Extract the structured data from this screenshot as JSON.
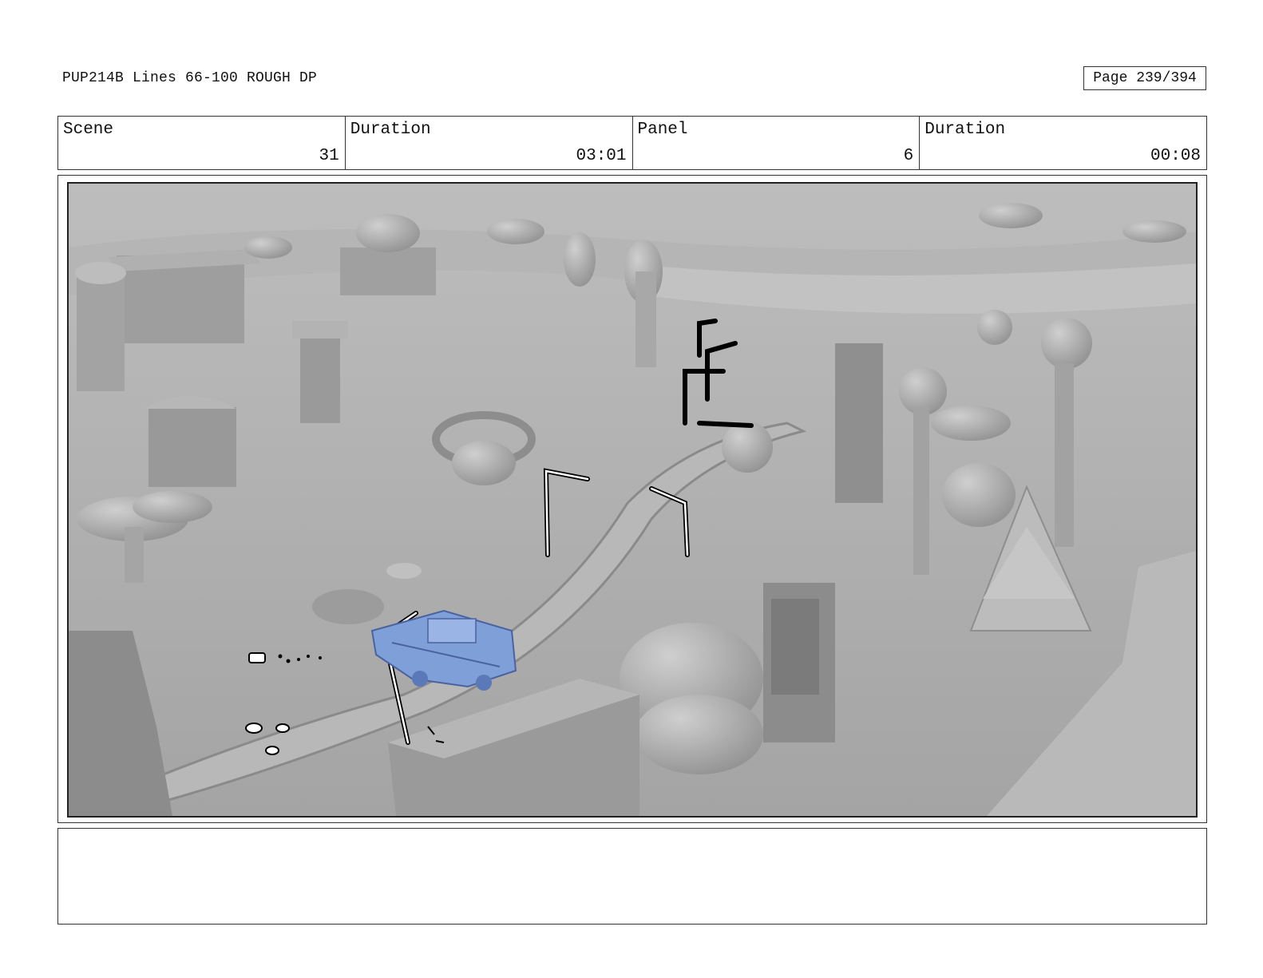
{
  "header": {
    "title": "PUP214B Lines 66-100 ROUGH DP",
    "page": "Page 239/394"
  },
  "info": {
    "scene_label": "Scene",
    "scene_value": "31",
    "scene_duration_label": "Duration",
    "scene_duration_value": "03:01",
    "panel_label": "Panel",
    "panel_value": "6",
    "panel_duration_label": "Duration",
    "panel_duration_value": "00:08"
  },
  "notes": {
    "text": ""
  },
  "colors": {
    "frame": "#333333",
    "scene_gray": "#a9a9a9",
    "vehicle_blue": "#7f9fd9"
  }
}
